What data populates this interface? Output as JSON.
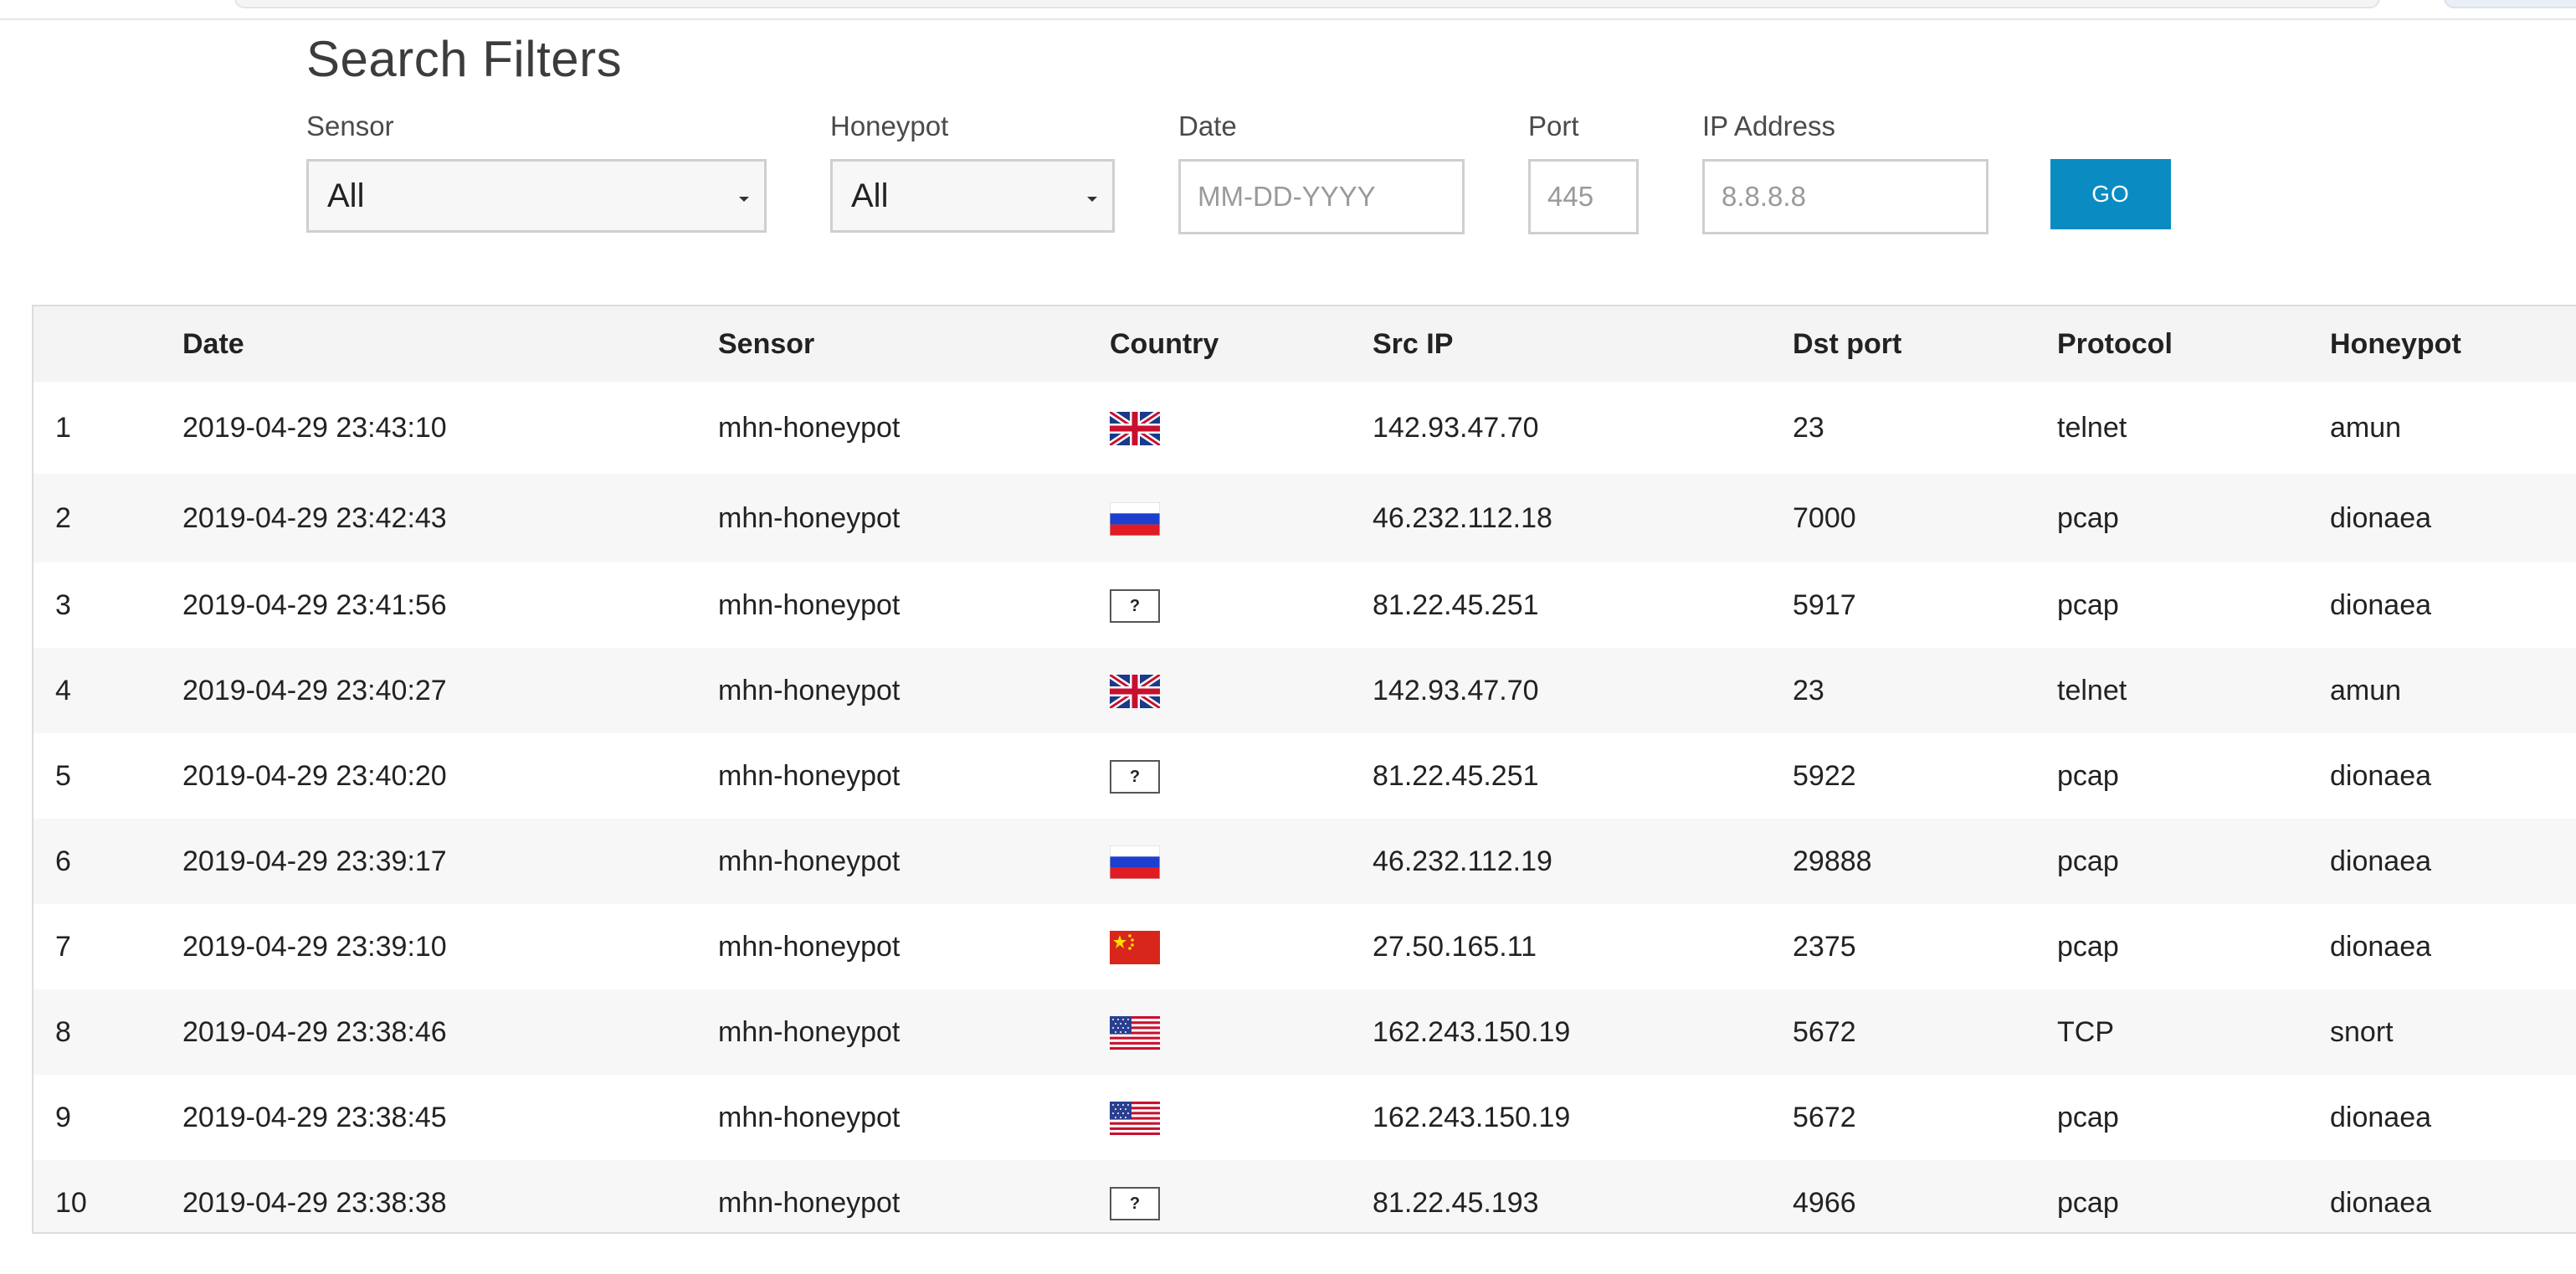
{
  "page_title": "Search Filters",
  "filters": {
    "sensor_label": "Sensor",
    "sensor_value": "All",
    "honeypot_label": "Honeypot",
    "honeypot_value": "All",
    "date_label": "Date",
    "date_placeholder": "MM-DD-YYYY",
    "port_label": "Port",
    "port_placeholder": "445",
    "ip_label": "IP Address",
    "ip_placeholder": "8.8.8.8",
    "go_label": "GO"
  },
  "table": {
    "headers": [
      "",
      "Date",
      "Sensor",
      "Country",
      "Src IP",
      "Dst port",
      "Protocol",
      "Honeypot"
    ],
    "rows": [
      {
        "num": "1",
        "date": "2019-04-29 23:43:10",
        "sensor": "mhn-honeypot",
        "country": "gb-flag",
        "src_ip": "142.93.47.70",
        "dst_port": "23",
        "protocol": "telnet",
        "honeypot": "amun"
      },
      {
        "num": "2",
        "date": "2019-04-29 23:42:43",
        "sensor": "mhn-honeypot",
        "country": "ru-flag",
        "src_ip": "46.232.112.18",
        "dst_port": "7000",
        "protocol": "pcap",
        "honeypot": "dionaea"
      },
      {
        "num": "3",
        "date": "2019-04-29 23:41:56",
        "sensor": "mhn-honeypot",
        "country": "unknown",
        "country_text": "?",
        "src_ip": "81.22.45.251",
        "dst_port": "5917",
        "protocol": "pcap",
        "honeypot": "dionaea"
      },
      {
        "num": "4",
        "date": "2019-04-29 23:40:27",
        "sensor": "mhn-honeypot",
        "country": "gb-flag",
        "src_ip": "142.93.47.70",
        "dst_port": "23",
        "protocol": "telnet",
        "honeypot": "amun"
      },
      {
        "num": "5",
        "date": "2019-04-29 23:40:20",
        "sensor": "mhn-honeypot",
        "country": "unknown",
        "country_text": "?",
        "src_ip": "81.22.45.251",
        "dst_port": "5922",
        "protocol": "pcap",
        "honeypot": "dionaea"
      },
      {
        "num": "6",
        "date": "2019-04-29 23:39:17",
        "sensor": "mhn-honeypot",
        "country": "ru-flag",
        "src_ip": "46.232.112.19",
        "dst_port": "29888",
        "protocol": "pcap",
        "honeypot": "dionaea"
      },
      {
        "num": "7",
        "date": "2019-04-29 23:39:10",
        "sensor": "mhn-honeypot",
        "country": "cn-flag",
        "src_ip": "27.50.165.11",
        "dst_port": "2375",
        "protocol": "pcap",
        "honeypot": "dionaea"
      },
      {
        "num": "8",
        "date": "2019-04-29 23:38:46",
        "sensor": "mhn-honeypot",
        "country": "us-flag",
        "src_ip": "162.243.150.19",
        "dst_port": "5672",
        "protocol": "TCP",
        "honeypot": "snort"
      },
      {
        "num": "9",
        "date": "2019-04-29 23:38:45",
        "sensor": "mhn-honeypot",
        "country": "us-flag",
        "src_ip": "162.243.150.19",
        "dst_port": "5672",
        "protocol": "pcap",
        "honeypot": "dionaea"
      },
      {
        "num": "10",
        "date": "2019-04-29 23:38:38",
        "sensor": "mhn-honeypot",
        "country": "unknown",
        "country_text": "?",
        "src_ip": "81.22.45.193",
        "dst_port": "4966",
        "protocol": "pcap",
        "honeypot": "dionaea"
      }
    ]
  },
  "colors": {
    "go_button": "#0a8cc3",
    "header_bg": "#f4f4f4",
    "stripe_bg": "#f7f7f7"
  }
}
